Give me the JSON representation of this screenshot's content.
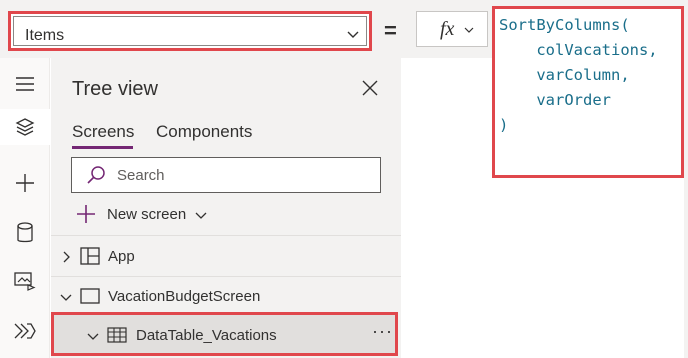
{
  "formula_bar": {
    "property": "Items",
    "equals": "=",
    "fx_label": "fx",
    "formula_text": "SortByColumns(\n    colVacations,\n    varColumn,\n    varOrder\n)"
  },
  "rail": {
    "icons": [
      "hamburger-menu-icon",
      "layers-icon",
      "plus-icon",
      "database-icon",
      "media-icon",
      "power-automate-icon"
    ]
  },
  "tree_view": {
    "title": "Tree view",
    "tabs": [
      "Screens",
      "Components"
    ],
    "search_placeholder": "Search",
    "new_screen_label": "New screen",
    "nodes": {
      "app": "App",
      "screen": "VacationBudgetScreen",
      "datatable": "DataTable_Vacations",
      "more": "···"
    }
  },
  "colors": {
    "highlight": "#e0474c",
    "accent": "#742774",
    "formula_text": "#1a6e8a"
  }
}
